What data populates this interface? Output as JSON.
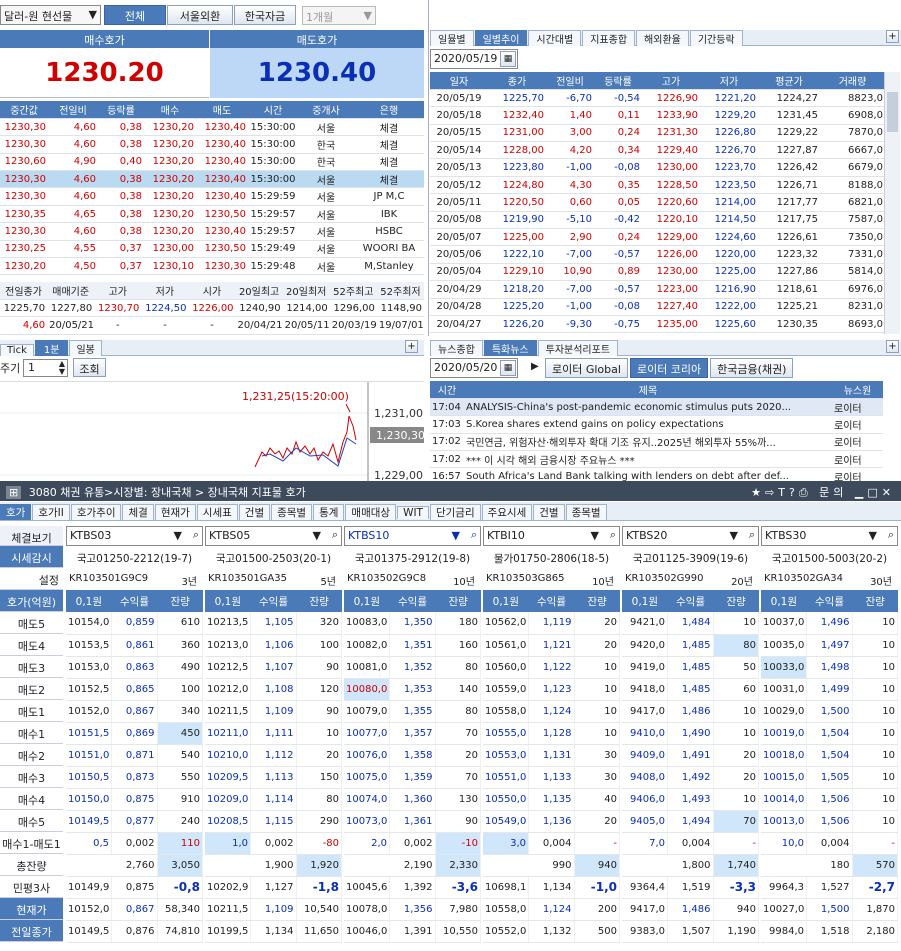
{
  "top": {
    "currency_select": "달러-원 현선물",
    "btn_all": "전체",
    "btn_seoul": "서울외환",
    "btn_korea": "한국자금",
    "period": "1개월"
  },
  "quote": {
    "bid_label": "매수호가",
    "ask_label": "매도호가",
    "bid": "1230.20",
    "ask": "1230.40"
  },
  "ticks": {
    "headers": [
      "중간값",
      "전일비",
      "등락률",
      "매수",
      "매도",
      "시간",
      "중개사",
      "은행"
    ],
    "rows": [
      [
        "1230,30",
        "4,60",
        "0,38",
        "1230,20",
        "1230,40",
        "15:30:00",
        "서울",
        "체결"
      ],
      [
        "1230,30",
        "4,60",
        "0,38",
        "1230,20",
        "1230,40",
        "15:30:00",
        "한국",
        "체결"
      ],
      [
        "1230,60",
        "4,90",
        "0,40",
        "1230,20",
        "1230,40",
        "15:30:00",
        "한국",
        "체결"
      ],
      [
        "1230,30",
        "4,60",
        "0,38",
        "1230,20",
        "1230,40",
        "15:30:00",
        "서울",
        "체결"
      ],
      [
        "1230,30",
        "4,60",
        "0,38",
        "1230,20",
        "1230,40",
        "15:29:59",
        "서울",
        "JP M,C"
      ],
      [
        "1230,35",
        "4,65",
        "0,38",
        "1230,20",
        "1230,50",
        "15:29:57",
        "서울",
        "IBK"
      ],
      [
        "1230,30",
        "4,60",
        "0,38",
        "1230,20",
        "1230,40",
        "15:29:57",
        "서울",
        "HSBC"
      ],
      [
        "1230,25",
        "4,55",
        "0,37",
        "1230,00",
        "1230,50",
        "15:29:49",
        "서울",
        "WOORI BA"
      ],
      [
        "1230,20",
        "4,50",
        "0,37",
        "1230,10",
        "1230,30",
        "15:29:48",
        "서울",
        "M,Stanley"
      ]
    ]
  },
  "summary": {
    "headers": [
      "전일종가",
      "매매기준",
      "고가",
      "저가",
      "시가",
      "20일최고",
      "20일최저",
      "52주최고",
      "52주최저"
    ],
    "row1": [
      "1225,70",
      "1227,80",
      "1230,70",
      "1224,50",
      "1226,00",
      "1240,90",
      "1214,00",
      "1296,00",
      "1148,90"
    ],
    "row2": [
      "4,60",
      "20/05/21",
      "-",
      "-",
      "-",
      "20/04/21",
      "20/05/11",
      "20/03/19",
      "19/07/01"
    ]
  },
  "chart": {
    "tabs": [
      "Tick",
      "1분",
      "일봉"
    ],
    "period_label": "주기",
    "period_value": "1",
    "lookup": "조회",
    "peak_label": "1,231,25(15:20:00)",
    "ticks": [
      "1,231,00",
      "1,230,30",
      "1,229,00"
    ]
  },
  "daily": {
    "tabs": [
      "일뮬별",
      "일별추이",
      "시간대별",
      "지표종합",
      "해외환율",
      "기간등락"
    ],
    "date": "2020/05/19",
    "headers": [
      "일자",
      "종가",
      "전일비",
      "등락률",
      "고가",
      "저가",
      "평균가",
      "거래량"
    ],
    "rows": [
      [
        "20/05/19",
        "1225,70",
        "-6,70",
        "-0,54",
        "1226,90",
        "1221,20",
        "1224,27",
        "8823,0"
      ],
      [
        "20/05/18",
        "1232,40",
        "1,40",
        "0,11",
        "1233,90",
        "1229,20",
        "1231,45",
        "6908,0"
      ],
      [
        "20/05/15",
        "1231,00",
        "3,00",
        "0,24",
        "1231,30",
        "1226,80",
        "1229,22",
        "7870,0"
      ],
      [
        "20/05/14",
        "1228,00",
        "4,20",
        "0,34",
        "1229,40",
        "1226,70",
        "1227,87",
        "6667,0"
      ],
      [
        "20/05/13",
        "1223,80",
        "-1,00",
        "-0,08",
        "1230,00",
        "1223,70",
        "1226,42",
        "6679,0"
      ],
      [
        "20/05/12",
        "1224,80",
        "4,30",
        "0,35",
        "1228,50",
        "1223,50",
        "1226,71",
        "8188,0"
      ],
      [
        "20/05/11",
        "1220,50",
        "0,60",
        "0,05",
        "1220,60",
        "1214,00",
        "1217,77",
        "6821,0"
      ],
      [
        "20/05/08",
        "1219,90",
        "-5,10",
        "-0,42",
        "1220,10",
        "1214,50",
        "1217,75",
        "7587,0"
      ],
      [
        "20/05/07",
        "1225,00",
        "2,90",
        "0,24",
        "1229,00",
        "1224,60",
        "1226,61",
        "7350,0"
      ],
      [
        "20/05/06",
        "1222,10",
        "-7,00",
        "-0,57",
        "1226,00",
        "1220,00",
        "1223,32",
        "7331,0"
      ],
      [
        "20/05/04",
        "1229,10",
        "10,90",
        "0,89",
        "1230,00",
        "1225,00",
        "1227,86",
        "5814,0"
      ],
      [
        "20/04/29",
        "1218,20",
        "-7,00",
        "-0,57",
        "1223,00",
        "1216,90",
        "1218,61",
        "6976,0"
      ],
      [
        "20/04/28",
        "1225,20",
        "-1,00",
        "-0,08",
        "1227,40",
        "1222,00",
        "1225,21",
        "8231,0"
      ],
      [
        "20/04/27",
        "1226,20",
        "-9,30",
        "-0,75",
        "1235,00",
        "1225,60",
        "1230,35",
        "8693,0"
      ]
    ]
  },
  "news": {
    "tabs": [
      "뉴스종합",
      "특화뉴스",
      "투자분석리포트"
    ],
    "date": "2020/05/20",
    "src_tabs": [
      "로이터 Global",
      "로이터 코리아",
      "한국금융(채권)"
    ],
    "headers": [
      "시간",
      "제목",
      "뉴스원"
    ],
    "rows": [
      [
        "17:04",
        "ANALYSIS-China's post-pandemic economic stimulus puts 2020...",
        "로이터"
      ],
      [
        "17:03",
        "S.Korea shares extend gains on policy expectations",
        "로이터"
      ],
      [
        "17:02",
        "국민연금, 위험자산·해외투자 확대 기조 유지..2025년 해외투자 55%까...",
        "로이터"
      ],
      [
        "17:02",
        "*** 이 시각 해외 금융시장 주요뉴스 ***",
        "로이터"
      ],
      [
        "16:57",
        "South Africa's Land Bank talking with lenders on debt after def...",
        "로이터"
      ]
    ]
  },
  "window": {
    "title": "3080 채권 유통>시장별: 장내국채 > 장내국채 지표물 호가",
    "menu_label": "문의"
  },
  "maintabs": [
    "호가",
    "호가II",
    "호가추이",
    "체결",
    "현재가",
    "시세표",
    "건별",
    "종목별",
    "통계",
    "매매대상",
    "WIT",
    "단기금리",
    "주요시세",
    "건별",
    "종목별"
  ],
  "left_labels": [
    "체결보기",
    "시세감시",
    "설정",
    "호가(억원)",
    "매도5",
    "매도4",
    "매도3",
    "매도2",
    "매도1",
    "매수1",
    "매수2",
    "매수3",
    "매수4",
    "매수5",
    "매수1-매도1",
    "총잔량",
    "민평3사",
    "현재가",
    "전일종가"
  ],
  "bonds": [
    {
      "code": "KTBS03",
      "name": "국고01250-2212(19-7)",
      "isin": "KR103501G9C9",
      "tenor": "3년",
      "sell": [
        [
          "10154,0",
          "0,859",
          "610"
        ],
        [
          "10153,5",
          "0,861",
          "360"
        ],
        [
          "10153,0",
          "0,863",
          "490"
        ],
        [
          "10152,5",
          "0,865",
          "100"
        ],
        [
          "10152,0",
          "0,867",
          "340"
        ]
      ],
      "buy": [
        [
          "10151,5",
          "0,869",
          "450"
        ],
        [
          "10151,0",
          "0,871",
          "540"
        ],
        [
          "10150,5",
          "0,873",
          "550"
        ],
        [
          "10150,0",
          "0,875",
          "910"
        ],
        [
          "10149,5",
          "0,877",
          "240"
        ]
      ],
      "spread": [
        "0,5",
        "0,002",
        "110"
      ],
      "total": [
        "2,760",
        "3,050"
      ],
      "min": [
        "10149,9",
        "0,875",
        "-0,8"
      ],
      "cur": [
        "10152,0",
        "0,867",
        "58,340"
      ],
      "prev": [
        "10149,5",
        "0,876",
        "74,810"
      ]
    },
    {
      "code": "KTBS05",
      "name": "국고01500-2503(20-1)",
      "isin": "KR103501GA35",
      "tenor": "5년",
      "sell": [
        [
          "10213,5",
          "1,105",
          "320"
        ],
        [
          "10213,0",
          "1,106",
          "100"
        ],
        [
          "10212,5",
          "1,107",
          "90"
        ],
        [
          "10212,0",
          "1,108",
          "120"
        ],
        [
          "10211,5",
          "1,109",
          "90"
        ]
      ],
      "buy": [
        [
          "10211,0",
          "1,111",
          "10"
        ],
        [
          "10210,0",
          "1,112",
          "20"
        ],
        [
          "10209,5",
          "1,113",
          "150"
        ],
        [
          "10209,0",
          "1,114",
          "80"
        ],
        [
          "10208,5",
          "1,115",
          "290"
        ]
      ],
      "spread": [
        "1,0",
        "0,002",
        "-80"
      ],
      "total": [
        "1,900",
        "1,920"
      ],
      "min": [
        "10202,9",
        "1,127",
        "-1,8"
      ],
      "cur": [
        "10211,5",
        "1,109",
        "10,540"
      ],
      "prev": [
        "10199,5",
        "1,134",
        "11,650"
      ]
    },
    {
      "code": "KTBS10",
      "name": "국고01375-2912(19-8)",
      "isin": "KR103502G9C8",
      "tenor": "10년",
      "sell": [
        [
          "10083,0",
          "1,350",
          "180"
        ],
        [
          "10082,0",
          "1,351",
          "160"
        ],
        [
          "10081,0",
          "1,352",
          "80"
        ],
        [
          "10080,0",
          "1,353",
          "140"
        ],
        [
          "10079,0",
          "1,355",
          "80"
        ]
      ],
      "buy": [
        [
          "10077,0",
          "1,357",
          "70"
        ],
        [
          "10076,0",
          "1,358",
          "20"
        ],
        [
          "10075,0",
          "1,359",
          "70"
        ],
        [
          "10074,0",
          "1,360",
          "130"
        ],
        [
          "10073,0",
          "1,361",
          "90"
        ]
      ],
      "spread": [
        "2,0",
        "0,002",
        "-10"
      ],
      "total": [
        "2,190",
        "2,330"
      ],
      "min": [
        "10045,6",
        "1,392",
        "-3,6"
      ],
      "cur": [
        "10078,0",
        "1,356",
        "7,980"
      ],
      "prev": [
        "10046,0",
        "1,391",
        "10,550"
      ]
    },
    {
      "code": "KTBI10",
      "name": "물가01750-2806(18-5)",
      "isin": "KR103503G865",
      "tenor": "10년",
      "sell": [
        [
          "10562,0",
          "1,119",
          "20"
        ],
        [
          "10561,0",
          "1,121",
          "20"
        ],
        [
          "10560,0",
          "1,122",
          "10"
        ],
        [
          "10559,0",
          "1,123",
          "10"
        ],
        [
          "10558,0",
          "1,124",
          "10"
        ]
      ],
      "buy": [
        [
          "10555,0",
          "1,128",
          "10"
        ],
        [
          "10553,0",
          "1,131",
          "30"
        ],
        [
          "10551,0",
          "1,133",
          "30"
        ],
        [
          "10550,0",
          "1,135",
          "40"
        ],
        [
          "10549,0",
          "1,136",
          "20"
        ]
      ],
      "spread": [
        "3,0",
        "0,004",
        "-"
      ],
      "total": [
        "990",
        "940"
      ],
      "min": [
        "10698,1",
        "1,134",
        "-1,0"
      ],
      "cur": [
        "10558,0",
        "1,124",
        "200"
      ],
      "prev": [
        "10552,0",
        "1,132",
        "500"
      ]
    },
    {
      "code": "KTBS20",
      "name": "국고01125-3909(19-6)",
      "isin": "KR103502G990",
      "tenor": "20년",
      "sell": [
        [
          "9421,0",
          "1,484",
          "10"
        ],
        [
          "9420,0",
          "1,485",
          "80"
        ],
        [
          "9419,0",
          "1,485",
          "50"
        ],
        [
          "9418,0",
          "1,485",
          "60"
        ],
        [
          "9417,0",
          "1,486",
          "10"
        ]
      ],
      "buy": [
        [
          "9410,0",
          "1,490",
          "10"
        ],
        [
          "9409,0",
          "1,491",
          "20"
        ],
        [
          "9408,0",
          "1,492",
          "20"
        ],
        [
          "9406,0",
          "1,493",
          "10"
        ],
        [
          "9405,0",
          "1,494",
          "70"
        ]
      ],
      "spread": [
        "7,0",
        "0,004",
        "-"
      ],
      "total": [
        "1,800",
        "1,740"
      ],
      "min": [
        "9364,4",
        "1,519",
        "-3,3"
      ],
      "cur": [
        "9417,0",
        "1,486",
        "940"
      ],
      "prev": [
        "9383,0",
        "1,507",
        "1,190"
      ]
    },
    {
      "code": "KTBS30",
      "name": "국고01500-5003(20-2)",
      "isin": "KR103502GA34",
      "tenor": "30년",
      "sell": [
        [
          "10037,0",
          "1,496",
          "10"
        ],
        [
          "10035,0",
          "1,497",
          "10"
        ],
        [
          "10033,0",
          "1,498",
          "10"
        ],
        [
          "10031,0",
          "1,499",
          "10"
        ],
        [
          "10029,0",
          "1,500",
          "10"
        ]
      ],
      "buy": [
        [
          "10019,0",
          "1,504",
          "10"
        ],
        [
          "10018,0",
          "1,504",
          "10"
        ],
        [
          "10015,0",
          "1,505",
          "10"
        ],
        [
          "10014,0",
          "1,506",
          "10"
        ],
        [
          "10013,0",
          "1,506",
          "10"
        ]
      ],
      "spread": [
        "10,0",
        "0,004",
        "-"
      ],
      "total": [
        "180",
        "570"
      ],
      "min": [
        "9964,3",
        "1,527",
        "-2,7"
      ],
      "cur": [
        "10027,0",
        "1,500",
        "1,870"
      ],
      "prev": [
        "9984,0",
        "1,518",
        "2,180"
      ]
    }
  ],
  "col_headers": [
    "0,1원",
    "수익률",
    "잔량"
  ]
}
